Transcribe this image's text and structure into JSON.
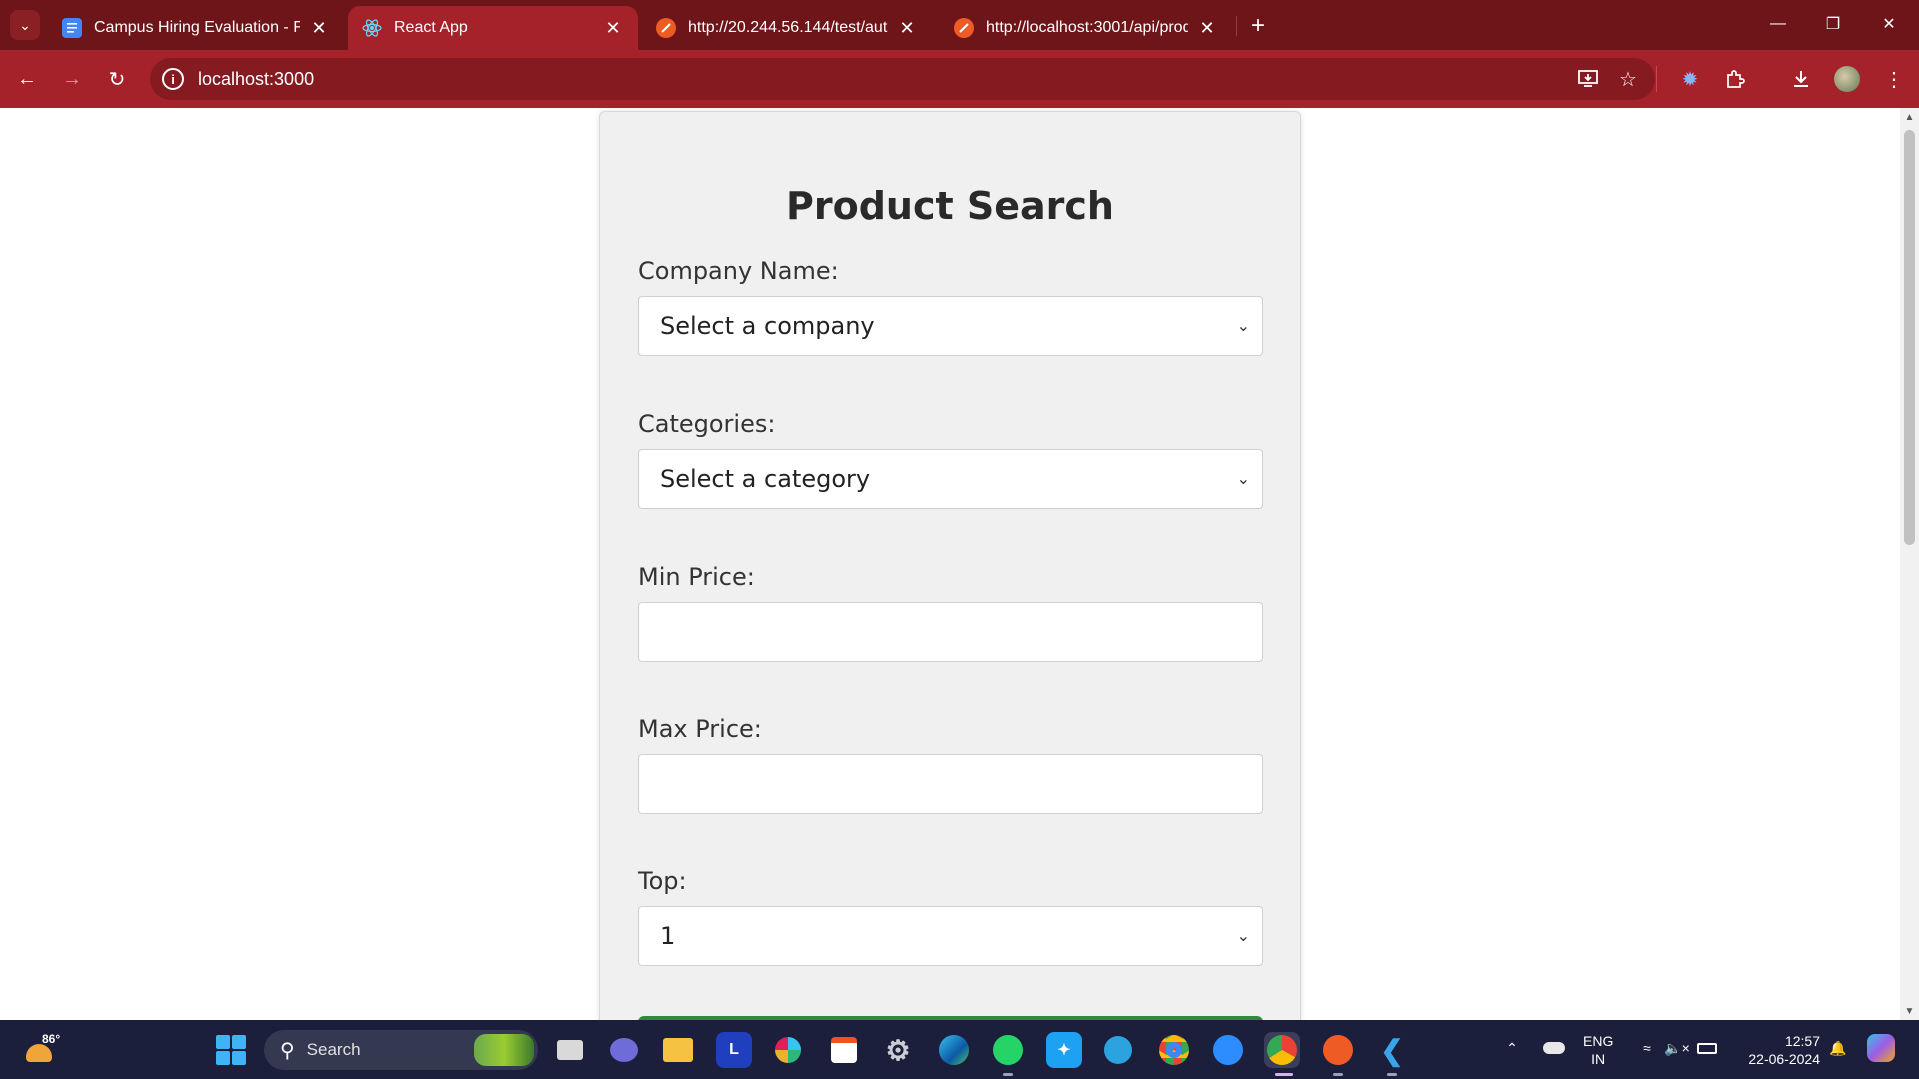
{
  "browser": {
    "tabs": [
      {
        "title": "Campus Hiring Evaluation - Full",
        "favicon": "docs-icon",
        "active": false
      },
      {
        "title": "React App",
        "favicon": "react-icon",
        "active": true
      },
      {
        "title": "http://20.244.56.144/test/auth",
        "favicon": "postman-icon",
        "active": false
      },
      {
        "title": "http://localhost:3001/api/produ",
        "favicon": "postman-icon",
        "active": false
      }
    ],
    "url": "localhost:3000"
  },
  "form": {
    "title": "Product Search",
    "company_label": "Company Name:",
    "company_value": "Select a company",
    "categories_label": "Categories:",
    "categories_value": "Select a category",
    "min_price_label": "Min Price:",
    "min_price_value": "",
    "max_price_label": "Max Price:",
    "max_price_value": "",
    "top_label": "Top:",
    "top_value": "1",
    "submit_color": "#2e8b3a"
  },
  "taskbar": {
    "weather_temp": "86°",
    "search_placeholder": "Search",
    "lang_top": "ENG",
    "lang_bottom": "IN",
    "time": "12:57",
    "date": "22-06-2024"
  },
  "colors": {
    "tab_strip": "#6e1519",
    "toolbar": "#a5222a",
    "card_bg": "#f0f0f0",
    "taskbar": "#1c1f3b"
  }
}
